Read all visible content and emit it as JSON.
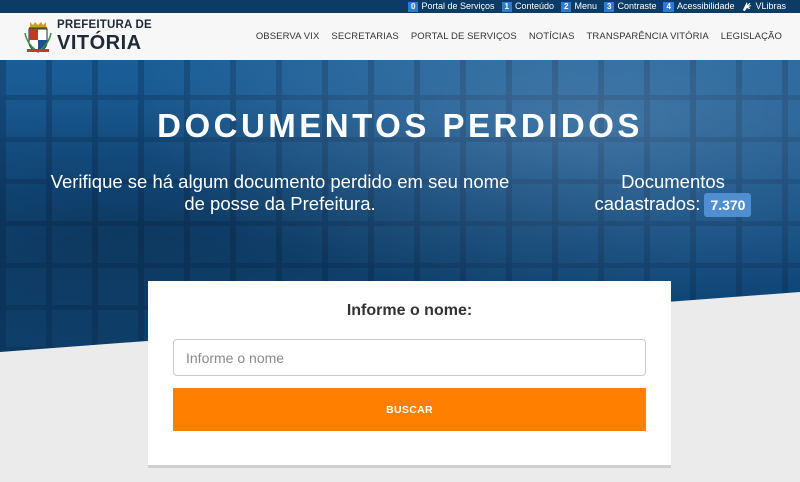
{
  "access_bar": {
    "items": [
      {
        "key": "0",
        "label": "Portal de Serviços"
      },
      {
        "key": "1",
        "label": "Conteúdo"
      },
      {
        "key": "2",
        "label": "Menu"
      },
      {
        "key": "3",
        "label": "Contraste"
      },
      {
        "key": "4",
        "label": "Acessibilidade"
      }
    ],
    "vlibras_label": "VLibras"
  },
  "header": {
    "logo_line1": "PREFEITURA DE",
    "logo_line2": "VITÓRIA",
    "nav": [
      {
        "label": "OBSERVA VIX"
      },
      {
        "label": "SECRETARIAS"
      },
      {
        "label": "PORTAL DE SERVIÇOS"
      },
      {
        "label": "NOTÍCIAS"
      },
      {
        "label": "TRANSPARÊNCIA VITÓRIA"
      },
      {
        "label": "LEGISLAÇÃO"
      }
    ]
  },
  "hero": {
    "title": "DOCUMENTOS PERDIDOS",
    "subtitle": "Verifique se há algum documento perdido em seu nome de posse da Prefeitura.",
    "count_line1": "Documentos",
    "count_line2": "cadastrados:",
    "count_value": "7.370"
  },
  "search": {
    "label": "Informe o nome:",
    "placeholder": "Informe o nome",
    "value": "",
    "button_label": "BUSCAR"
  },
  "colors": {
    "top_bar": "#0c3b66",
    "key_badge": "#2e7bd4",
    "hero_blue": "#134f86",
    "count_badge": "#4f8fd1",
    "button_orange": "#ff7f00",
    "page_bg": "#ebebeb"
  },
  "icons": {
    "vlibras": "hand-icon",
    "logo": "crest-icon"
  }
}
